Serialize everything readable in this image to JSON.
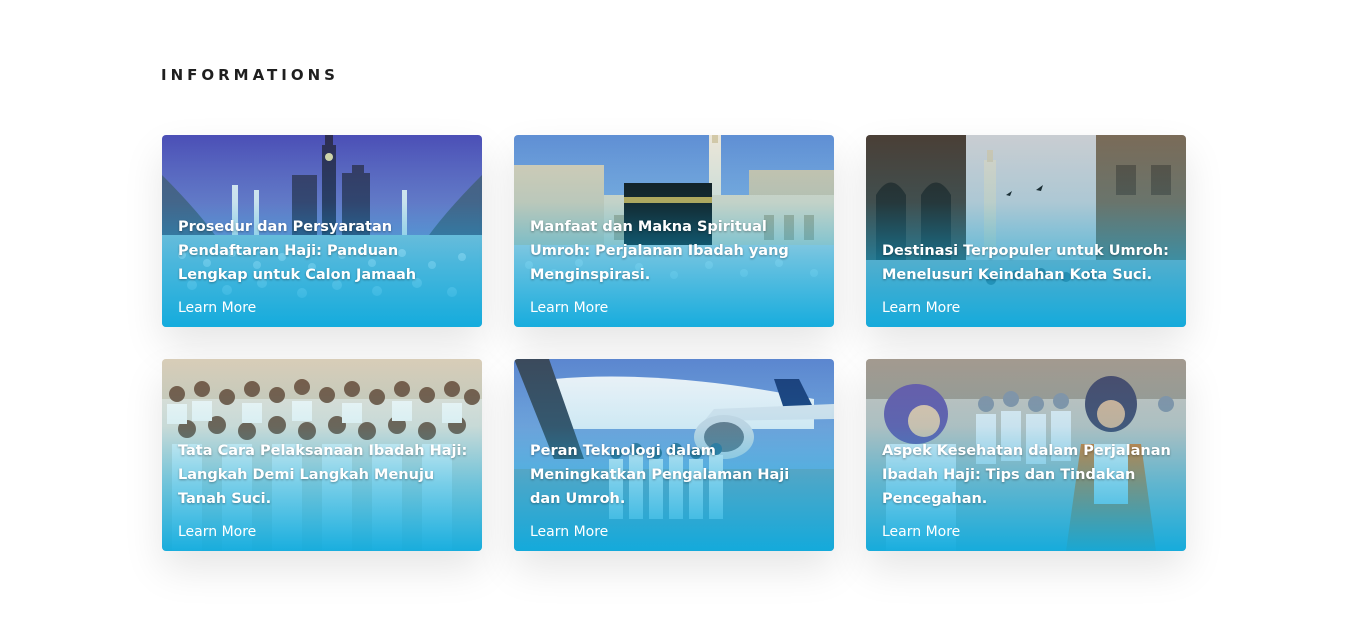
{
  "section": {
    "title": "INFORMATIONS"
  },
  "cards": [
    {
      "title": "Prosedur dan Persyaratan Pendaftaran Haji: Panduan Lengkap untuk Calon Jamaah",
      "link_label": "Learn More"
    },
    {
      "title": "Manfaat dan Makna Spiritual Umroh: Perjalanan Ibadah yang Menginspirasi.",
      "link_label": "Learn More"
    },
    {
      "title": "Destinasi Terpopuler untuk Umroh: Menelusuri Keindahan Kota Suci.",
      "link_label": "Learn More"
    },
    {
      "title": "Tata Cara Pelaksanaan Ibadah Haji: Langkah Demi Langkah Menuju Tanah Suci.",
      "link_label": "Learn More"
    },
    {
      "title": "Peran Teknologi dalam Meningkatkan Pengalaman Haji dan Umroh.",
      "link_label": "Learn More"
    },
    {
      "title": "Aspek Kesehatan dalam Perjalanan Ibadah Haji: Tips dan Tindakan Pencegahan.",
      "link_label": "Learn More"
    }
  ],
  "colors": {
    "overlay_accent": "#0DAADD",
    "title_text": "#1F1F1F",
    "card_text": "#FFFFFF"
  }
}
